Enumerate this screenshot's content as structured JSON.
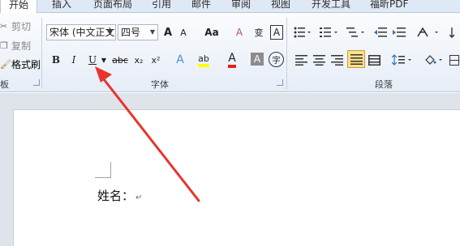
{
  "tabs": [
    "开始",
    "插入",
    "页面布局",
    "引用",
    "邮件",
    "审阅",
    "视图",
    "开发工具",
    "福昕PDF"
  ],
  "clipboard": {
    "cut": "剪切",
    "copy": "复制",
    "format_painter": "格式刷",
    "group_label": "板"
  },
  "font": {
    "font_name": "宋体 (中文正文",
    "font_size": "四号",
    "grow": "A",
    "shrink": "A",
    "change_case": "Aa",
    "clear_format": "A",
    "phonetic": "变",
    "char_border": "A",
    "bold": "B",
    "italic": "I",
    "underline": "U",
    "strike": "abc",
    "subscript": "x₂",
    "superscript": "x²",
    "text_effect": "A",
    "highlight": "ab",
    "font_color": "A",
    "char_shading": "A",
    "enclose": "字",
    "group_label": "字体"
  },
  "paragraph": {
    "group_label": "段落"
  },
  "document": {
    "line1": "姓名：",
    "para_mark": "↵"
  },
  "colors": {
    "accent_tab": "#dfe9f5",
    "highlight_yellow": "#ffff00",
    "font_red": "#e0201b",
    "annotation_arrow": "#e8342c"
  }
}
